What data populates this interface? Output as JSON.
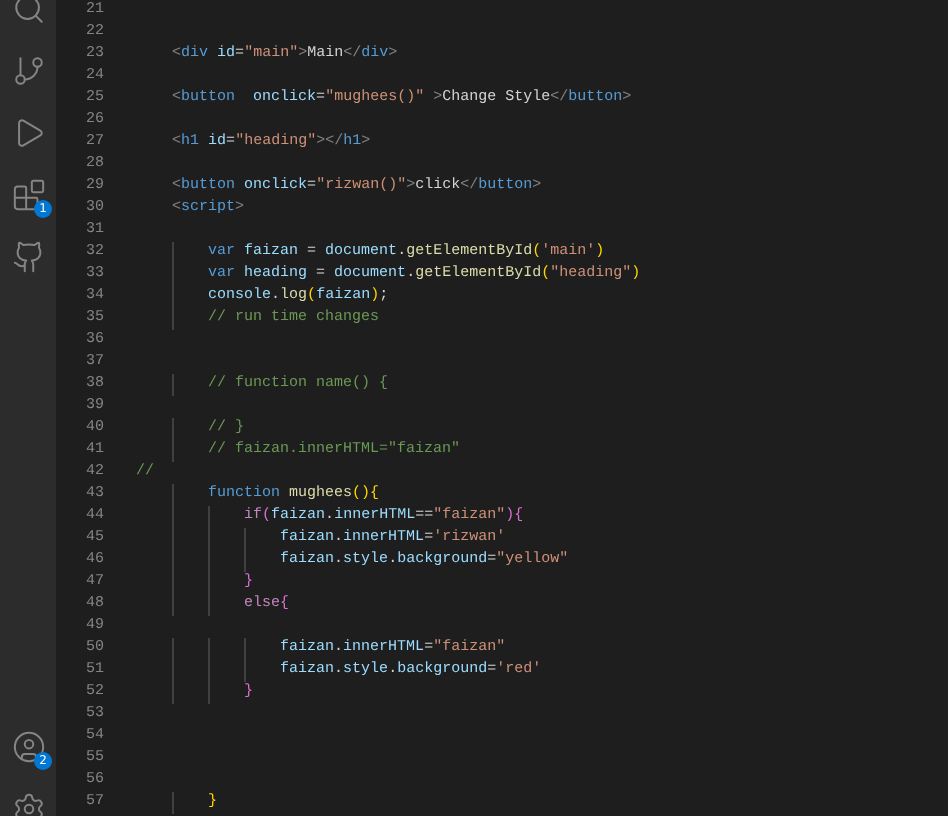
{
  "activity_bar": {
    "top": [
      {
        "kind": "search"
      },
      {
        "kind": "source-control"
      },
      {
        "kind": "run"
      },
      {
        "kind": "extensions",
        "badge": "1"
      },
      {
        "kind": "github"
      }
    ],
    "bottom": [
      {
        "kind": "accounts",
        "badge": "2"
      },
      {
        "kind": "settings"
      }
    ]
  },
  "editor": {
    "lines": [
      {
        "number": "21"
      },
      {
        "number": "22"
      },
      {
        "number": "23",
        "tokens": [
          {
            "kind": "punct",
            "text": "    <"
          },
          {
            "kind": "tag",
            "text": "div"
          },
          {
            "kind": "attr",
            "text": " id"
          },
          {
            "kind": "plain",
            "text": "="
          },
          {
            "kind": "string",
            "text": "\"main\""
          },
          {
            "kind": "punct",
            "text": ">"
          },
          {
            "kind": "plain",
            "text": "Main"
          },
          {
            "kind": "punct",
            "text": "</"
          },
          {
            "kind": "tag",
            "text": "div"
          },
          {
            "kind": "punct",
            "text": ">"
          }
        ]
      },
      {
        "number": "24"
      },
      {
        "number": "25",
        "tokens": [
          {
            "kind": "punct",
            "text": "    <"
          },
          {
            "kind": "tag",
            "text": "button"
          },
          {
            "kind": "attr",
            "text": "  onclick"
          },
          {
            "kind": "plain",
            "text": "="
          },
          {
            "kind": "string",
            "text": "\"mughees()\""
          },
          {
            "kind": "punct",
            "text": " >"
          },
          {
            "kind": "plain",
            "text": "Change Style"
          },
          {
            "kind": "punct",
            "text": "</"
          },
          {
            "kind": "tag",
            "text": "button"
          },
          {
            "kind": "punct",
            "text": ">"
          }
        ]
      },
      {
        "number": "26"
      },
      {
        "number": "27",
        "tokens": [
          {
            "kind": "punct",
            "text": "    <"
          },
          {
            "kind": "tag",
            "text": "h1"
          },
          {
            "kind": "attr",
            "text": " id"
          },
          {
            "kind": "plain",
            "text": "="
          },
          {
            "kind": "string",
            "text": "\"heading\""
          },
          {
            "kind": "punct",
            "text": "></"
          },
          {
            "kind": "tag",
            "text": "h1"
          },
          {
            "kind": "punct",
            "text": ">"
          }
        ]
      },
      {
        "number": "28"
      },
      {
        "number": "29",
        "tokens": [
          {
            "kind": "punct",
            "text": "    <"
          },
          {
            "kind": "tag",
            "text": "button"
          },
          {
            "kind": "attr",
            "text": " onclick"
          },
          {
            "kind": "plain",
            "text": "="
          },
          {
            "kind": "string",
            "text": "\"rizwan()\""
          },
          {
            "kind": "punct",
            "text": ">"
          },
          {
            "kind": "plain",
            "text": "click"
          },
          {
            "kind": "punct",
            "text": "</"
          },
          {
            "kind": "tag",
            "text": "button"
          },
          {
            "kind": "punct",
            "text": ">"
          }
        ]
      },
      {
        "number": "30",
        "tokens": [
          {
            "kind": "punct",
            "text": "    <"
          },
          {
            "kind": "tag",
            "text": "script"
          },
          {
            "kind": "punct",
            "text": ">"
          }
        ]
      },
      {
        "number": "31"
      },
      {
        "number": "32",
        "tokens": [
          {
            "kind": "keyword",
            "text": "        var"
          },
          {
            "kind": "var",
            "text": " faizan"
          },
          {
            "kind": "plain",
            "text": " = "
          },
          {
            "kind": "var",
            "text": "document"
          },
          {
            "kind": "plain",
            "text": "."
          },
          {
            "kind": "func",
            "text": "getElementById"
          },
          {
            "kind": "bracket",
            "text": "("
          },
          {
            "kind": "string",
            "text": "'main'"
          },
          {
            "kind": "bracket",
            "text": ")"
          }
        ]
      },
      {
        "number": "33",
        "tokens": [
          {
            "kind": "keyword",
            "text": "        var"
          },
          {
            "kind": "var",
            "text": " heading"
          },
          {
            "kind": "plain",
            "text": " = "
          },
          {
            "kind": "var",
            "text": "document"
          },
          {
            "kind": "plain",
            "text": "."
          },
          {
            "kind": "func",
            "text": "getElementById"
          },
          {
            "kind": "bracket",
            "text": "("
          },
          {
            "kind": "string",
            "text": "\"heading\""
          },
          {
            "kind": "bracket",
            "text": ")"
          }
        ]
      },
      {
        "number": "34",
        "tokens": [
          {
            "kind": "var",
            "text": "        console"
          },
          {
            "kind": "plain",
            "text": "."
          },
          {
            "kind": "func",
            "text": "log"
          },
          {
            "kind": "bracket",
            "text": "("
          },
          {
            "kind": "var",
            "text": "faizan"
          },
          {
            "kind": "bracket",
            "text": ")"
          },
          {
            "kind": "plain",
            "text": ";"
          }
        ]
      },
      {
        "number": "35",
        "tokens": [
          {
            "kind": "comment",
            "text": "        // run time changes"
          }
        ]
      },
      {
        "number": "36"
      },
      {
        "number": "37"
      },
      {
        "number": "38",
        "tokens": [
          {
            "kind": "comment",
            "text": "        // function name() {"
          }
        ]
      },
      {
        "number": "39"
      },
      {
        "number": "40",
        "tokens": [
          {
            "kind": "comment",
            "text": "        // }"
          }
        ]
      },
      {
        "number": "41",
        "tokens": [
          {
            "kind": "comment",
            "text": "        // faizan.innerHTML=\"faizan\""
          }
        ]
      },
      {
        "number": "42",
        "tokens": [
          {
            "kind": "comment",
            "text": "//"
          }
        ]
      },
      {
        "number": "43",
        "tokens": [
          {
            "kind": "keyword",
            "text": "        function"
          },
          {
            "kind": "func",
            "text": " mughees"
          },
          {
            "kind": "bracket",
            "text": "(){"
          }
        ]
      },
      {
        "number": "44",
        "tokens": [
          {
            "kind": "control",
            "text": "            if"
          },
          {
            "kind": "bracket2",
            "text": "("
          },
          {
            "kind": "var",
            "text": "faizan"
          },
          {
            "kind": "plain",
            "text": "."
          },
          {
            "kind": "var",
            "text": "innerHTML"
          },
          {
            "kind": "plain",
            "text": "=="
          },
          {
            "kind": "string",
            "text": "\"faizan\""
          },
          {
            "kind": "bracket2",
            "text": "){"
          }
        ]
      },
      {
        "number": "45",
        "tokens": [
          {
            "kind": "var",
            "text": "                faizan"
          },
          {
            "kind": "plain",
            "text": "."
          },
          {
            "kind": "var",
            "text": "innerHTML"
          },
          {
            "kind": "plain",
            "text": "="
          },
          {
            "kind": "string",
            "text": "'rizwan'"
          }
        ]
      },
      {
        "number": "46",
        "tokens": [
          {
            "kind": "var",
            "text": "                faizan"
          },
          {
            "kind": "plain",
            "text": "."
          },
          {
            "kind": "var",
            "text": "style"
          },
          {
            "kind": "plain",
            "text": "."
          },
          {
            "kind": "var",
            "text": "background"
          },
          {
            "kind": "plain",
            "text": "="
          },
          {
            "kind": "string",
            "text": "\"yellow\""
          }
        ]
      },
      {
        "number": "47",
        "tokens": [
          {
            "kind": "bracket2",
            "text": "            }"
          }
        ]
      },
      {
        "number": "48",
        "tokens": [
          {
            "kind": "control",
            "text": "            else"
          },
          {
            "kind": "bracket2",
            "text": "{"
          }
        ]
      },
      {
        "number": "49"
      },
      {
        "number": "50",
        "tokens": [
          {
            "kind": "var",
            "text": "                faizan"
          },
          {
            "kind": "plain",
            "text": "."
          },
          {
            "kind": "var",
            "text": "innerHTML"
          },
          {
            "kind": "plain",
            "text": "="
          },
          {
            "kind": "string",
            "text": "\"faizan\""
          }
        ]
      },
      {
        "number": "51",
        "tokens": [
          {
            "kind": "var",
            "text": "                faizan"
          },
          {
            "kind": "plain",
            "text": "."
          },
          {
            "kind": "var",
            "text": "style"
          },
          {
            "kind": "plain",
            "text": "."
          },
          {
            "kind": "var",
            "text": "background"
          },
          {
            "kind": "plain",
            "text": "="
          },
          {
            "kind": "string",
            "text": "'red'"
          }
        ]
      },
      {
        "number": "52",
        "tokens": [
          {
            "kind": "bracket2",
            "text": "            }"
          }
        ]
      },
      {
        "number": "53"
      },
      {
        "number": "54"
      },
      {
        "number": "55"
      },
      {
        "number": "56"
      },
      {
        "number": "57",
        "tokens": [
          {
            "kind": "bracket",
            "text": "        }"
          }
        ]
      }
    ]
  }
}
